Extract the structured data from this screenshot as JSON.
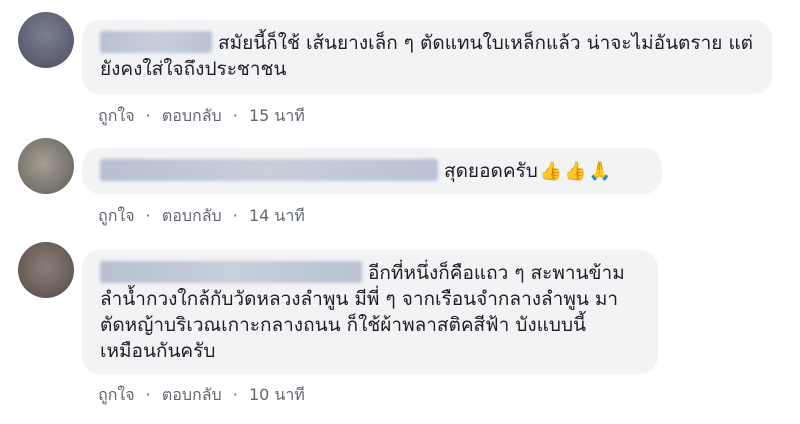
{
  "comments": [
    {
      "text": "สมัยนี้ก็ใช้ เส้นยางเล็ก ๆ ตัดแทนใบเหล็กแล้ว น่าจะไม่อันตราย แต่ยังคงใส่ใจถึงประชาชน",
      "like_label": "ถูกใจ",
      "separator": "·",
      "reply_label": "ตอบกลับ",
      "timestamp": "15 นาที"
    },
    {
      "text": "สุดยอดครับ",
      "emojis": [
        "👍",
        "👍",
        "🙏"
      ],
      "like_label": "ถูกใจ",
      "separator": "·",
      "reply_label": "ตอบกลับ",
      "timestamp": "14 นาที"
    },
    {
      "text": "อีกที่หนึ่งก็คือแถว ๆ สะพานข้ามลำน้ำกวงใกล้กับวัดหลวงลำพูน มีพี่ ๆ จากเรือนจำกลางลำพูน มาตัดหญ้าบริเวณเกาะกลางถนน ก็ใช้ผ้าพลาสติคสีฟ้า บังแบบนี้เหมือนกันครับ",
      "like_label": "ถูกใจ",
      "separator": "·",
      "reply_label": "ตอบกลับ",
      "timestamp": "10 นาที"
    }
  ],
  "colors": {
    "bubble": "#f2f3f5",
    "text": "#1c1e21",
    "meta": "#606770"
  }
}
